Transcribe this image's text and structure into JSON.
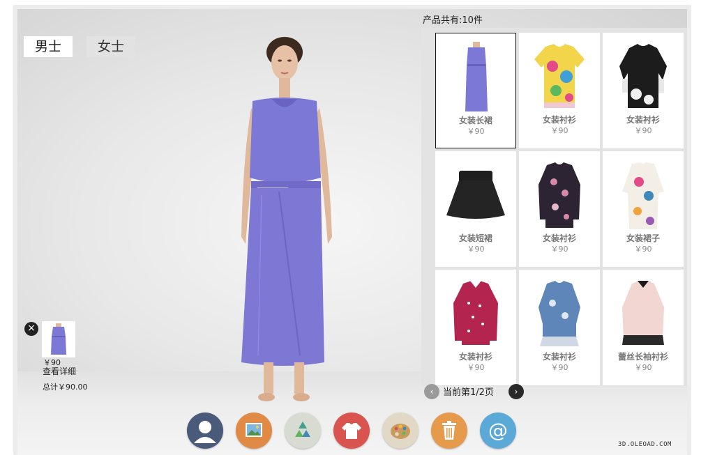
{
  "gender_tabs": {
    "male": "男士",
    "female": "女士"
  },
  "product_count": "产品共有:10件",
  "products": [
    {
      "name": "女装长裙",
      "price": "￥90",
      "icon": "purple-dress"
    },
    {
      "name": "女装衬衫",
      "price": "￥90",
      "icon": "floral-shirt"
    },
    {
      "name": "女装衬衫",
      "price": "￥90",
      "icon": "black-floral-top"
    },
    {
      "name": "女装短裙",
      "price": "￥90",
      "icon": "black-skirt"
    },
    {
      "name": "女装衬衫",
      "price": "￥90",
      "icon": "floral-blouse"
    },
    {
      "name": "女装裙子",
      "price": "￥90",
      "icon": "floral-dress"
    },
    {
      "name": "女装衬衫",
      "price": "￥90",
      "icon": "polka-dot-shirt"
    },
    {
      "name": "女装衬衫",
      "price": "￥90",
      "icon": "blue-blouse"
    },
    {
      "name": "蕾丝长袖衬衫",
      "price": "￥90",
      "icon": "lace-blouse"
    }
  ],
  "pager": {
    "text": "当前第1/2页",
    "prev_icon": "chevron-left-icon",
    "next_icon": "chevron-right-icon"
  },
  "cart": {
    "price": "￥90",
    "detail_link": "查看详细",
    "total": "总计￥90.00",
    "remove_icon": "close-icon"
  },
  "toolbar": [
    {
      "name": "avatar-button",
      "icon": "person-icon",
      "color": "#4a5a7a"
    },
    {
      "name": "background-button",
      "icon": "picture-icon",
      "color": "#e08a45"
    },
    {
      "name": "recycle-button",
      "icon": "recycle-icon",
      "color": "#d7dbd2"
    },
    {
      "name": "clothing-button",
      "icon": "tshirt-icon",
      "color": "#d9534f"
    },
    {
      "name": "palette-button",
      "icon": "palette-icon",
      "color": "#e1d9c6"
    },
    {
      "name": "trash-button",
      "icon": "trash-icon",
      "color": "#e59a4c"
    },
    {
      "name": "contact-button",
      "icon": "at-icon",
      "color": "#5aa9d6"
    }
  ],
  "watermark": "3D.OLEOAD.COM",
  "colors": {
    "dress": "#7a76d0",
    "panel": "#e3e3e3",
    "stage": "#e8e8e8"
  }
}
